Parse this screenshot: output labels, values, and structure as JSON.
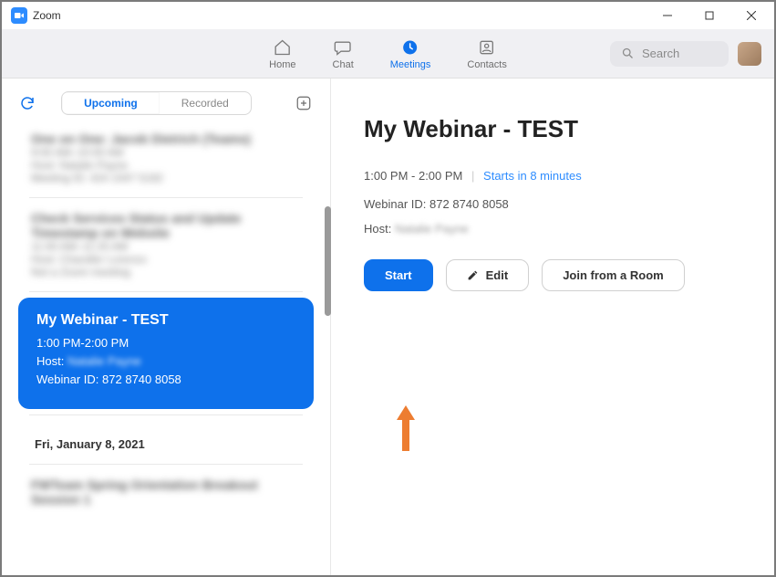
{
  "titlebar": {
    "app_name": "Zoom"
  },
  "nav": {
    "home": "Home",
    "chat": "Chat",
    "meetings": "Meetings",
    "contacts": "Contacts",
    "search_placeholder": "Search"
  },
  "sidebar": {
    "tabs": {
      "upcoming": "Upcoming",
      "recorded": "Recorded"
    },
    "selected": {
      "title": "My Webinar - TEST",
      "time": "1:00 PM-2:00 PM",
      "host_label": "Host:",
      "host_value": "Natalie Payne",
      "id_label": "Webinar ID:",
      "id_value": "872 8740 8058"
    },
    "date_heading": "Fri, January 8, 2021"
  },
  "detail": {
    "title": "My Webinar - TEST",
    "time_range": "1:00 PM - 2:00 PM",
    "starts_in": "Starts in 8 minutes",
    "webinar_id_label": "Webinar ID:",
    "webinar_id": "872 8740 8058",
    "host_label": "Host:",
    "host_value": "Natalie Payne",
    "buttons": {
      "start": "Start",
      "edit": "Edit",
      "join_room": "Join from a Room"
    }
  }
}
